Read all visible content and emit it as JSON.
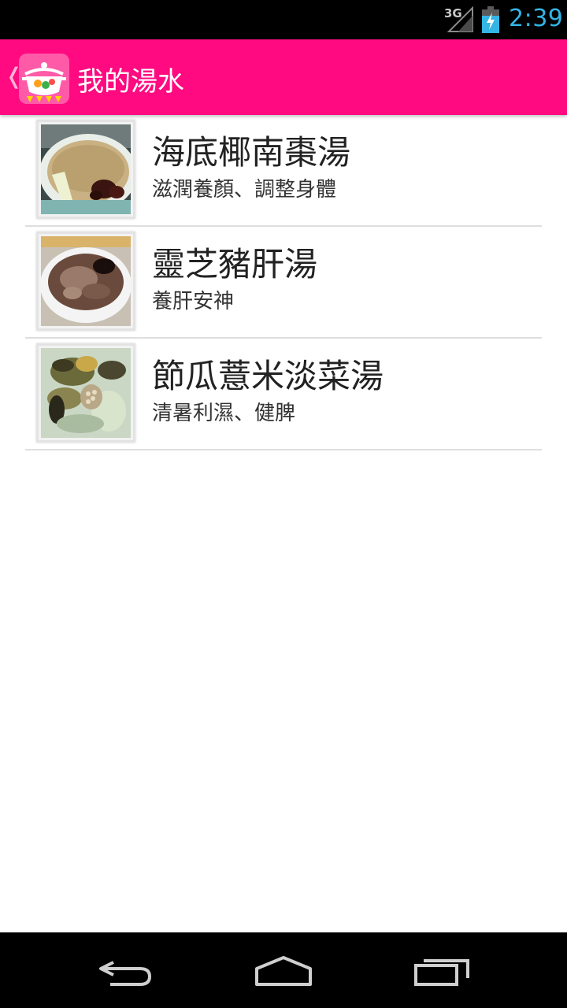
{
  "status_bar": {
    "network": "3G",
    "time": "2:39",
    "clock_color": "#33b5e5"
  },
  "action_bar": {
    "title": "我的湯水",
    "background_color": "#ff0a80",
    "up_icon": "chevron-left-icon",
    "app_icon": "soup-pot-icon"
  },
  "soups": [
    {
      "title": "海底椰南棗湯",
      "description": "滋潤養顏、調整身體",
      "thumbnail": "soup-photo"
    },
    {
      "title": "靈芝豬肝湯",
      "description": "養肝安神",
      "thumbnail": "soup-photo"
    },
    {
      "title": "節瓜薏米淡菜湯",
      "description": "清暑利濕、健脾",
      "thumbnail": "soup-photo"
    }
  ],
  "nav_bar": {
    "back_icon": "back-arrow-icon",
    "home_icon": "home-icon",
    "recents_icon": "recent-apps-icon"
  }
}
